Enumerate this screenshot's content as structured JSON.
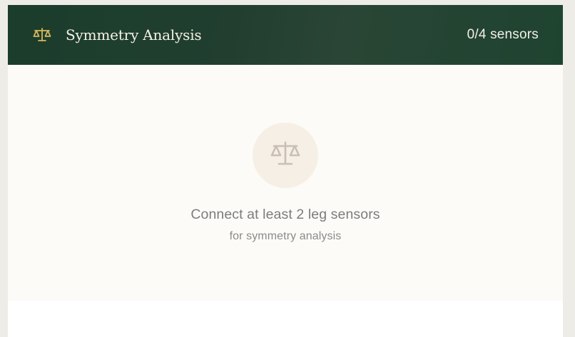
{
  "header": {
    "icon": "scale-icon",
    "title": "Symmetry Analysis",
    "sensor_count": "0/4 sensors"
  },
  "empty_state": {
    "icon": "scale-icon",
    "message": "Connect at least 2 leg sensors",
    "submessage": "for symmetry analysis"
  },
  "colors": {
    "header_bg": "#1f3f2e",
    "header_icon": "#d9b65c",
    "empty_icon": "#c8c0b6",
    "empty_circle": "#f5efe6"
  }
}
